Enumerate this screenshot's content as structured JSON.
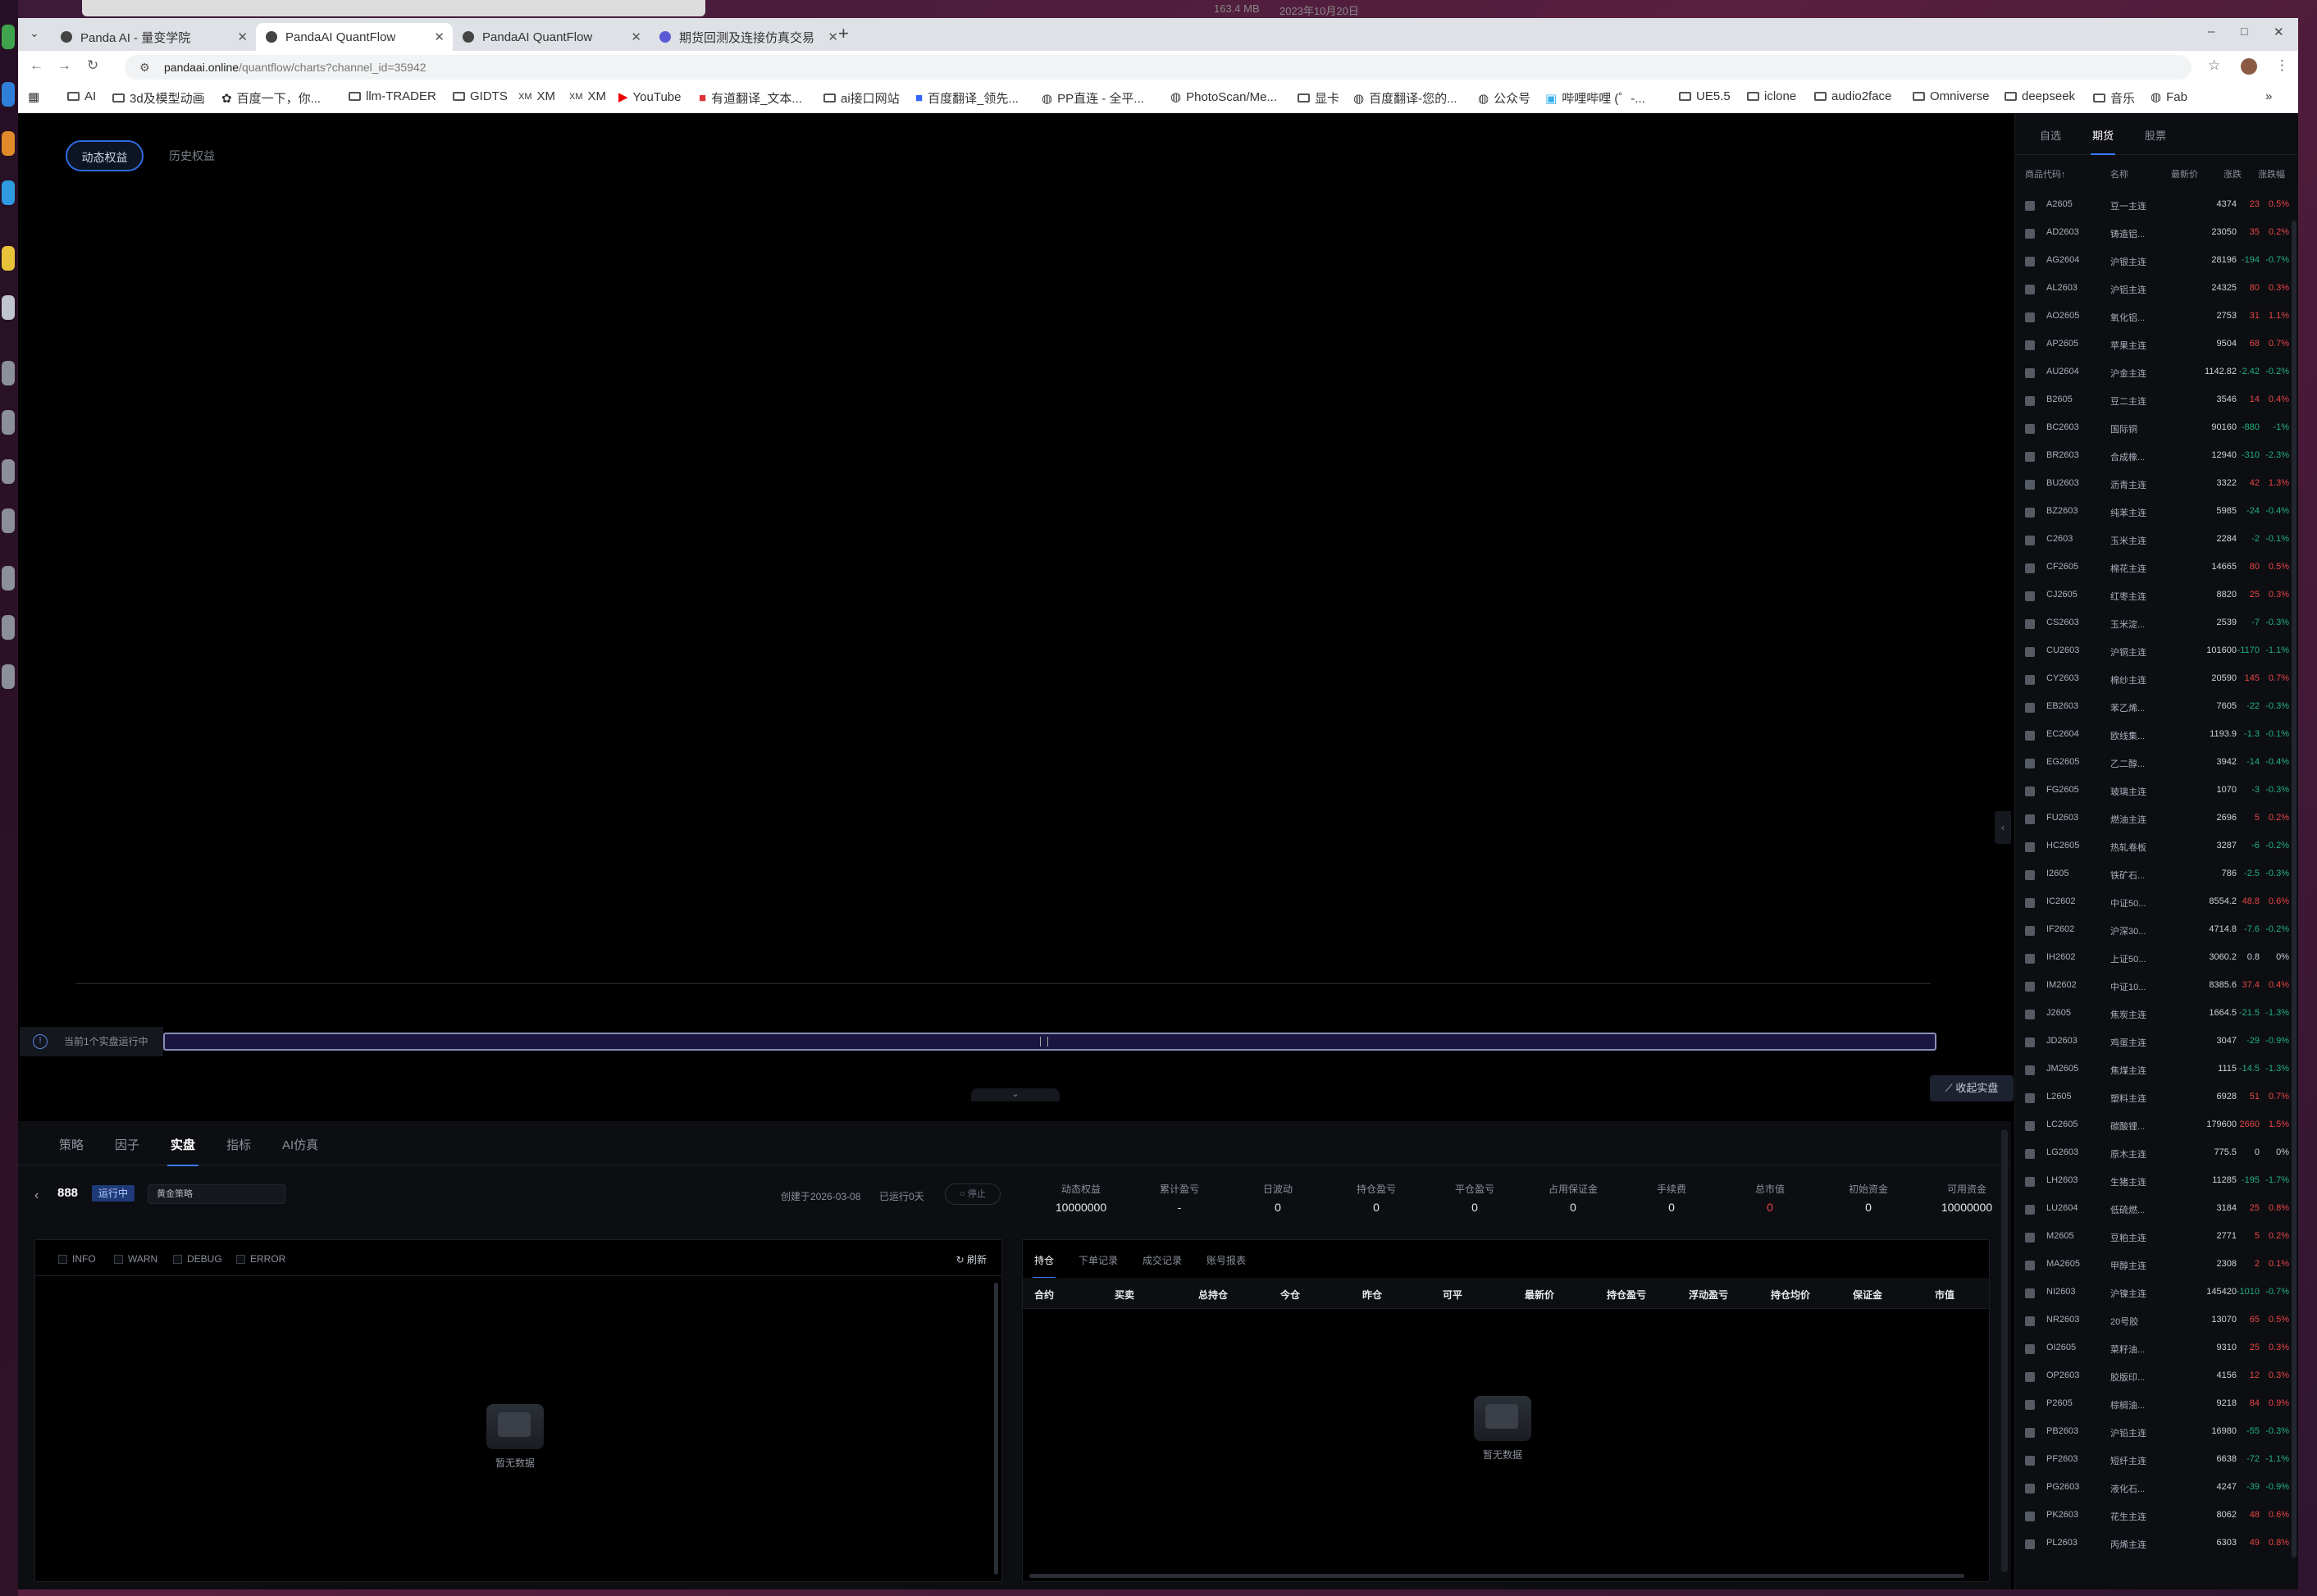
{
  "bg": {
    "size": "163.4 MB",
    "date": "2023年10月20日"
  },
  "tabs": [
    {
      "label": "Panda AI - 量变学院",
      "active": false
    },
    {
      "label": "PandaAI QuantFlow",
      "active": true
    },
    {
      "label": "PandaAI QuantFlow",
      "active": false
    },
    {
      "label": "期货回测及连接仿真交易",
      "active": false
    }
  ],
  "url": {
    "host": "pandaai.online",
    "path": "/quantflow/charts?channel_id=35942"
  },
  "bookmarks": [
    "AI",
    "3d及模型动画",
    "百度一下，你...",
    "llm-TRADER",
    "GIDTS",
    "XM",
    "XM",
    "YouTube",
    "有道翻译_文本...",
    "ai接口网站",
    "百度翻译_领先...",
    "PP直连 - 全平...",
    "PhotoScan/Me...",
    "显卡",
    "百度翻译-您的...",
    "公众号",
    "哔哩哔哩 (゜-...",
    "UE5.5",
    "iclone",
    "audio2face",
    "Omniverse",
    "deepseek",
    "音乐",
    "Fab"
  ],
  "chart": {
    "tab1": "动态权益",
    "tab2": "历史权益",
    "running_note": "当前1个实盘运行中",
    "close_live": "收起实盘"
  },
  "bottom": {
    "tabs": [
      "策略",
      "因子",
      "实盘",
      "指标",
      "AI仿真"
    ],
    "active_tab": 2
  },
  "strategy": {
    "name": "888",
    "status": "运行中",
    "type": "黄金策略",
    "created": "创建于2026-03-08",
    "running": "已运行0天",
    "stop": "停止"
  },
  "metrics": [
    {
      "label": "动态权益",
      "value": "10000000",
      "red": false
    },
    {
      "label": "累计盈亏",
      "value": "-",
      "red": false
    },
    {
      "label": "日波动",
      "value": "0",
      "red": false
    },
    {
      "label": "持仓盈亏",
      "value": "0",
      "red": false
    },
    {
      "label": "平仓盈亏",
      "value": "0",
      "red": false
    },
    {
      "label": "占用保证金",
      "value": "0",
      "red": false
    },
    {
      "label": "手续费",
      "value": "0",
      "red": false
    },
    {
      "label": "总市值",
      "value": "0",
      "red": true
    },
    {
      "label": "初始资金",
      "value": "0",
      "red": false
    },
    {
      "label": "可用资金",
      "value": "10000000",
      "red": false
    }
  ],
  "log": {
    "levels": [
      "INFO",
      "WARN",
      "DEBUG",
      "ERROR"
    ],
    "refresh": "刷新",
    "empty": "暂无数据"
  },
  "positions": {
    "tabs": [
      "持仓",
      "下单记录",
      "成交记录",
      "账号报表"
    ],
    "headers": [
      "合约",
      "买卖",
      "总持仓",
      "今仓",
      "昨仓",
      "可平",
      "最新价",
      "持仓盈亏",
      "浮动盈亏",
      "持仓均价",
      "保证金",
      "市值"
    ],
    "empty": "暂无数据"
  },
  "market": {
    "tabs": [
      "自选",
      "期货",
      "股票"
    ],
    "active": 1,
    "headers": [
      "商品代码↑",
      "名称",
      "最新价",
      "涨跌",
      "涨跌幅"
    ],
    "rows": [
      [
        "A2605",
        "豆一主连",
        "4374",
        "23",
        "0.5%",
        "up"
      ],
      [
        "AD2603",
        "铸造铝...",
        "23050",
        "35",
        "0.2%",
        "up"
      ],
      [
        "AG2604",
        "沪银主连",
        "28196",
        "-194",
        "-0.7%",
        "dn"
      ],
      [
        "AL2603",
        "沪铝主连",
        "24325",
        "80",
        "0.3%",
        "up"
      ],
      [
        "AO2605",
        "氧化铝...",
        "2753",
        "31",
        "1.1%",
        "up"
      ],
      [
        "AP2605",
        "苹果主连",
        "9504",
        "68",
        "0.7%",
        "up"
      ],
      [
        "AU2604",
        "沪金主连",
        "1142.82",
        "-2.42",
        "-0.2%",
        "dn"
      ],
      [
        "B2605",
        "豆二主连",
        "3546",
        "14",
        "0.4%",
        "up"
      ],
      [
        "BC2603",
        "国际铜",
        "90160",
        "-880",
        "-1%",
        "dn"
      ],
      [
        "BR2603",
        "合成橡...",
        "12940",
        "-310",
        "-2.3%",
        "dn"
      ],
      [
        "BU2603",
        "沥青主连",
        "3322",
        "42",
        "1.3%",
        "up"
      ],
      [
        "BZ2603",
        "纯苯主连",
        "5985",
        "-24",
        "-0.4%",
        "dn"
      ],
      [
        "C2603",
        "玉米主连",
        "2284",
        "-2",
        "-0.1%",
        "dn"
      ],
      [
        "CF2605",
        "棉花主连",
        "14665",
        "80",
        "0.5%",
        "up"
      ],
      [
        "CJ2605",
        "红枣主连",
        "8820",
        "25",
        "0.3%",
        "up"
      ],
      [
        "CS2603",
        "玉米淀...",
        "2539",
        "-7",
        "-0.3%",
        "dn"
      ],
      [
        "CU2603",
        "沪铜主连",
        "101600",
        "-1170",
        "-1.1%",
        "dn"
      ],
      [
        "CY2603",
        "棉纱主连",
        "20590",
        "145",
        "0.7%",
        "up"
      ],
      [
        "EB2603",
        "苯乙烯...",
        "7605",
        "-22",
        "-0.3%",
        "dn"
      ],
      [
        "EC2604",
        "欧线集...",
        "1193.9",
        "-1.3",
        "-0.1%",
        "dn"
      ],
      [
        "EG2605",
        "乙二醇...",
        "3942",
        "-14",
        "-0.4%",
        "dn"
      ],
      [
        "FG2605",
        "玻璃主连",
        "1070",
        "-3",
        "-0.3%",
        "dn"
      ],
      [
        "FU2603",
        "燃油主连",
        "2696",
        "5",
        "0.2%",
        "up"
      ],
      [
        "HC2605",
        "热轧卷板",
        "3287",
        "-6",
        "-0.2%",
        "dn"
      ],
      [
        "I2605",
        "铁矿石...",
        "786",
        "-2.5",
        "-0.3%",
        "dn"
      ],
      [
        "IC2602",
        "中证50...",
        "8554.2",
        "48.8",
        "0.6%",
        "up"
      ],
      [
        "IF2602",
        "沪深30...",
        "4714.8",
        "-7.6",
        "-0.2%",
        "dn"
      ],
      [
        "IH2602",
        "上证50...",
        "3060.2",
        "0.8",
        "0%",
        "fl"
      ],
      [
        "IM2602",
        "中证10...",
        "8385.6",
        "37.4",
        "0.4%",
        "up"
      ],
      [
        "J2605",
        "焦炭主连",
        "1664.5",
        "-21.5",
        "-1.3%",
        "dn"
      ],
      [
        "JD2603",
        "鸡蛋主连",
        "3047",
        "-29",
        "-0.9%",
        "dn"
      ],
      [
        "JM2605",
        "焦煤主连",
        "1115",
        "-14.5",
        "-1.3%",
        "dn"
      ],
      [
        "L2605",
        "塑料主连",
        "6928",
        "51",
        "0.7%",
        "up"
      ],
      [
        "LC2605",
        "碳酸锂...",
        "179600",
        "2660",
        "1.5%",
        "up"
      ],
      [
        "LG2603",
        "原木主连",
        "775.5",
        "0",
        "0%",
        "fl"
      ],
      [
        "LH2603",
        "生猪主连",
        "11285",
        "-195",
        "-1.7%",
        "dn"
      ],
      [
        "LU2604",
        "低硫燃...",
        "3184",
        "25",
        "0.8%",
        "up"
      ],
      [
        "M2605",
        "豆粕主连",
        "2771",
        "5",
        "0.2%",
        "up"
      ],
      [
        "MA2605",
        "甲醇主连",
        "2308",
        "2",
        "0.1%",
        "up"
      ],
      [
        "NI2603",
        "沪镍主连",
        "145420",
        "-1010",
        "-0.7%",
        "dn"
      ],
      [
        "NR2603",
        "20号胶",
        "13070",
        "65",
        "0.5%",
        "up"
      ],
      [
        "OI2605",
        "菜籽油...",
        "9310",
        "25",
        "0.3%",
        "up"
      ],
      [
        "OP2603",
        "胶版印...",
        "4156",
        "12",
        "0.3%",
        "up"
      ],
      [
        "P2605",
        "棕榈油...",
        "9218",
        "84",
        "0.9%",
        "up"
      ],
      [
        "PB2603",
        "沪铅主连",
        "16980",
        "-55",
        "-0.3%",
        "dn"
      ],
      [
        "PF2603",
        "短纤主连",
        "6638",
        "-72",
        "-1.1%",
        "dn"
      ],
      [
        "PG2603",
        "液化石...",
        "4247",
        "-39",
        "-0.9%",
        "dn"
      ],
      [
        "PK2603",
        "花生主连",
        "8062",
        "48",
        "0.6%",
        "up"
      ],
      [
        "PL2603",
        "丙烯主连",
        "6303",
        "49",
        "0.8%",
        "up"
      ]
    ]
  }
}
